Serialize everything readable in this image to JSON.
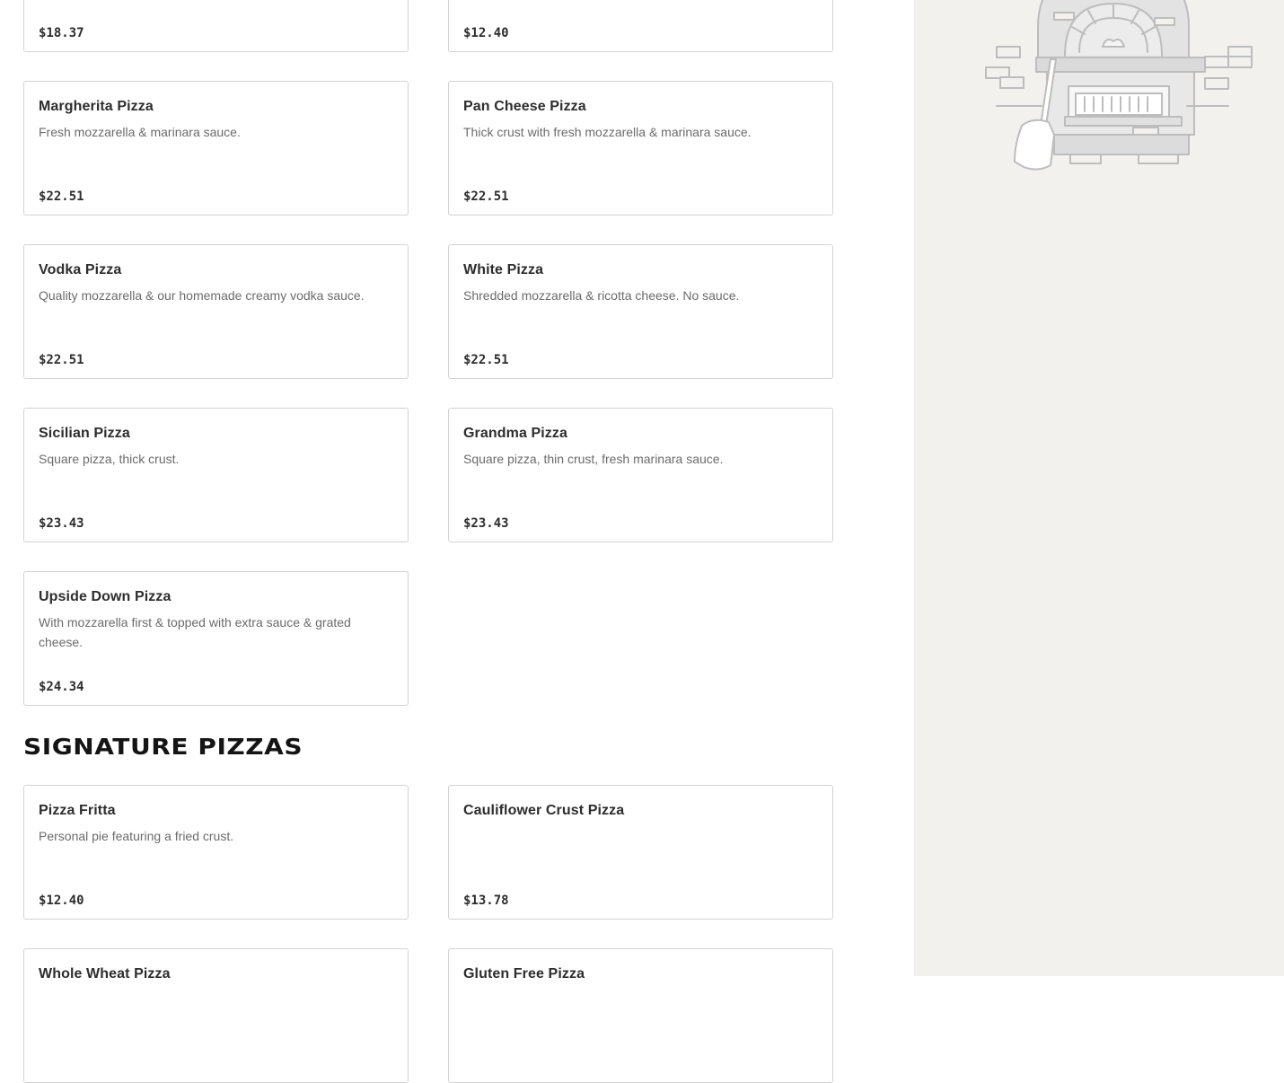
{
  "menu": {
    "items": [
      {
        "name": "",
        "description": "",
        "price": "$18.37"
      },
      {
        "name": "",
        "description": "",
        "price": "$12.40"
      },
      {
        "name": "Margherita Pizza",
        "description": "Fresh mozzarella & marinara sauce.",
        "price": "$22.51"
      },
      {
        "name": "Pan Cheese Pizza",
        "description": "Thick crust with fresh mozzarella & marinara sauce.",
        "price": "$22.51"
      },
      {
        "name": "Vodka Pizza",
        "description": "Quality mozzarella & our homemade creamy vodka sauce.",
        "price": "$22.51"
      },
      {
        "name": "White Pizza",
        "description": "Shredded mozzarella & ricotta cheese. No sauce.",
        "price": "$22.51"
      },
      {
        "name": "Sicilian Pizza",
        "description": "Square pizza, thick crust.",
        "price": "$23.43"
      },
      {
        "name": "Grandma Pizza",
        "description": "Square pizza, thin crust, fresh marinara sauce.",
        "price": "$23.43"
      },
      {
        "name": "Upside Down Pizza",
        "description": "With mozzarella first & topped with extra sauce & grated cheese.",
        "price": "$24.34"
      }
    ]
  },
  "signature": {
    "heading": "SIGNATURE PIZZAS",
    "items": [
      {
        "name": "Pizza Fritta",
        "description": "Personal pie featuring a fried crust.",
        "price": "$12.40"
      },
      {
        "name": "Cauliflower Crust Pizza",
        "description": "",
        "price": "$13.78"
      },
      {
        "name": "Whole Wheat Pizza",
        "description": "",
        "price": ""
      },
      {
        "name": "Gluten Free Pizza",
        "description": "",
        "price": ""
      }
    ]
  },
  "sidebar": {
    "illustration_icon": "pizza-oven-icon"
  },
  "colors": {
    "card_border": "#d3d3d3",
    "sidebar_background": "#f2f1ee",
    "description_text": "#6b6b6b"
  }
}
